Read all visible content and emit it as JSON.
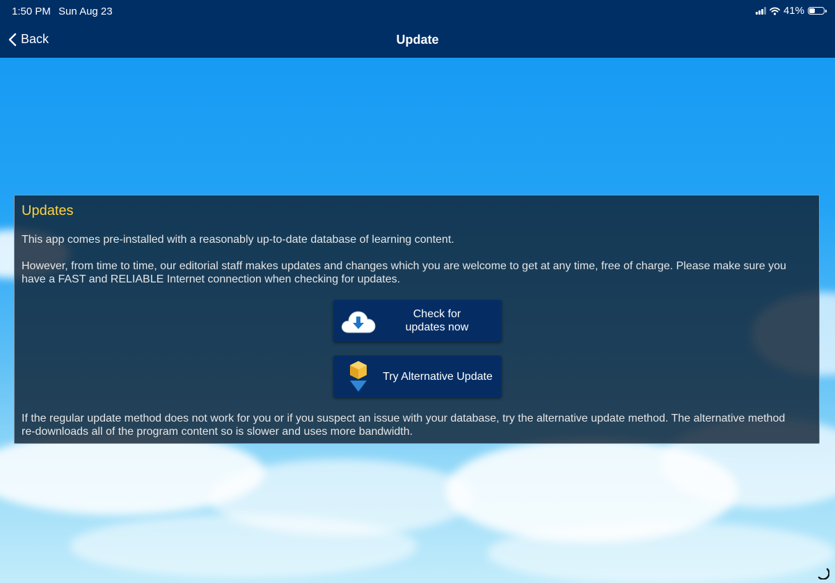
{
  "status_bar": {
    "time": "1:50 PM",
    "date": "Sun Aug 23",
    "battery_percent": "41%",
    "battery_level": 0.41,
    "signal_icon": "cellular-signal-icon",
    "wifi_icon": "wifi-icon"
  },
  "nav": {
    "back_label": "Back",
    "back_icon": "chevron-left-icon",
    "title": "Update"
  },
  "panel": {
    "title": "Updates",
    "intro": "This app comes pre-installed with a reasonably up-to-date database of learning content.",
    "notice_line1": "However, from time to time, our editorial staff makes updates and changes which you are welcome to get at any time, free of charge. Please make sure you",
    "notice_line2": "have a FAST and RELIABLE Internet connection when checking for updates.",
    "check_button_line1": "Check for",
    "check_button_line2": "updates now",
    "check_button_icon": "cloud-download-icon",
    "alt_button_label": "Try Alternative Update",
    "alt_button_icon": "package-download-icon",
    "footer_line1": "If the regular update method does not work for you or if you suspect an issue with your database, try the alternative update method. The alternative method",
    "footer_line2": "re-downloads all of the program content so is slower and uses more bandwidth."
  },
  "colors": {
    "header_bg": "#002f66",
    "panel_title": "#ffd341",
    "button_bg": "#062d63",
    "sky": "#1397f2"
  }
}
